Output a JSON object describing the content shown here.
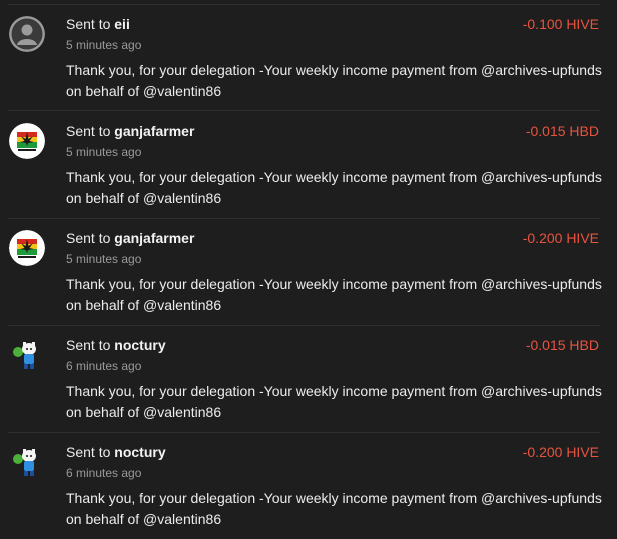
{
  "transactions": [
    {
      "prefix": "Sent to",
      "recipient": "eii",
      "time": "5 minutes ago",
      "amount": "-0.100 HIVE",
      "memo": "Thank you, for your delegation -Your weekly income payment from @archives-upfunds on behalf of @valentin86",
      "avatar": "default-user-icon"
    },
    {
      "prefix": "Sent to",
      "recipient": "ganjafarmer",
      "time": "5 minutes ago",
      "amount": "-0.015 HBD",
      "memo": "Thank you, for your delegation -Your weekly income payment from @archives-upfunds on behalf of @valentin86",
      "avatar": "ganjafarmer-logo"
    },
    {
      "prefix": "Sent to",
      "recipient": "ganjafarmer",
      "time": "5 minutes ago",
      "amount": "-0.200 HIVE",
      "memo": "Thank you, for your delegation -Your weekly income payment from @archives-upfunds on behalf of @valentin86",
      "avatar": "ganjafarmer-logo"
    },
    {
      "prefix": "Sent to",
      "recipient": "noctury",
      "time": "6 minutes ago",
      "amount": "-0.015 HBD",
      "memo": "Thank you, for your delegation -Your weekly income payment from @archives-upfunds on behalf of @valentin86",
      "avatar": "cartoon-character-avatar"
    },
    {
      "prefix": "Sent to",
      "recipient": "noctury",
      "time": "6 minutes ago",
      "amount": "-0.200 HIVE",
      "memo": "Thank you, for your delegation -Your weekly income payment from @archives-upfunds on behalf of @valentin86",
      "avatar": "cartoon-character-avatar"
    }
  ],
  "colors": {
    "background": "#1e1e1f",
    "amount": "#e8543f",
    "timestamp": "#9a9a9a",
    "divider": "#2e2e30"
  }
}
